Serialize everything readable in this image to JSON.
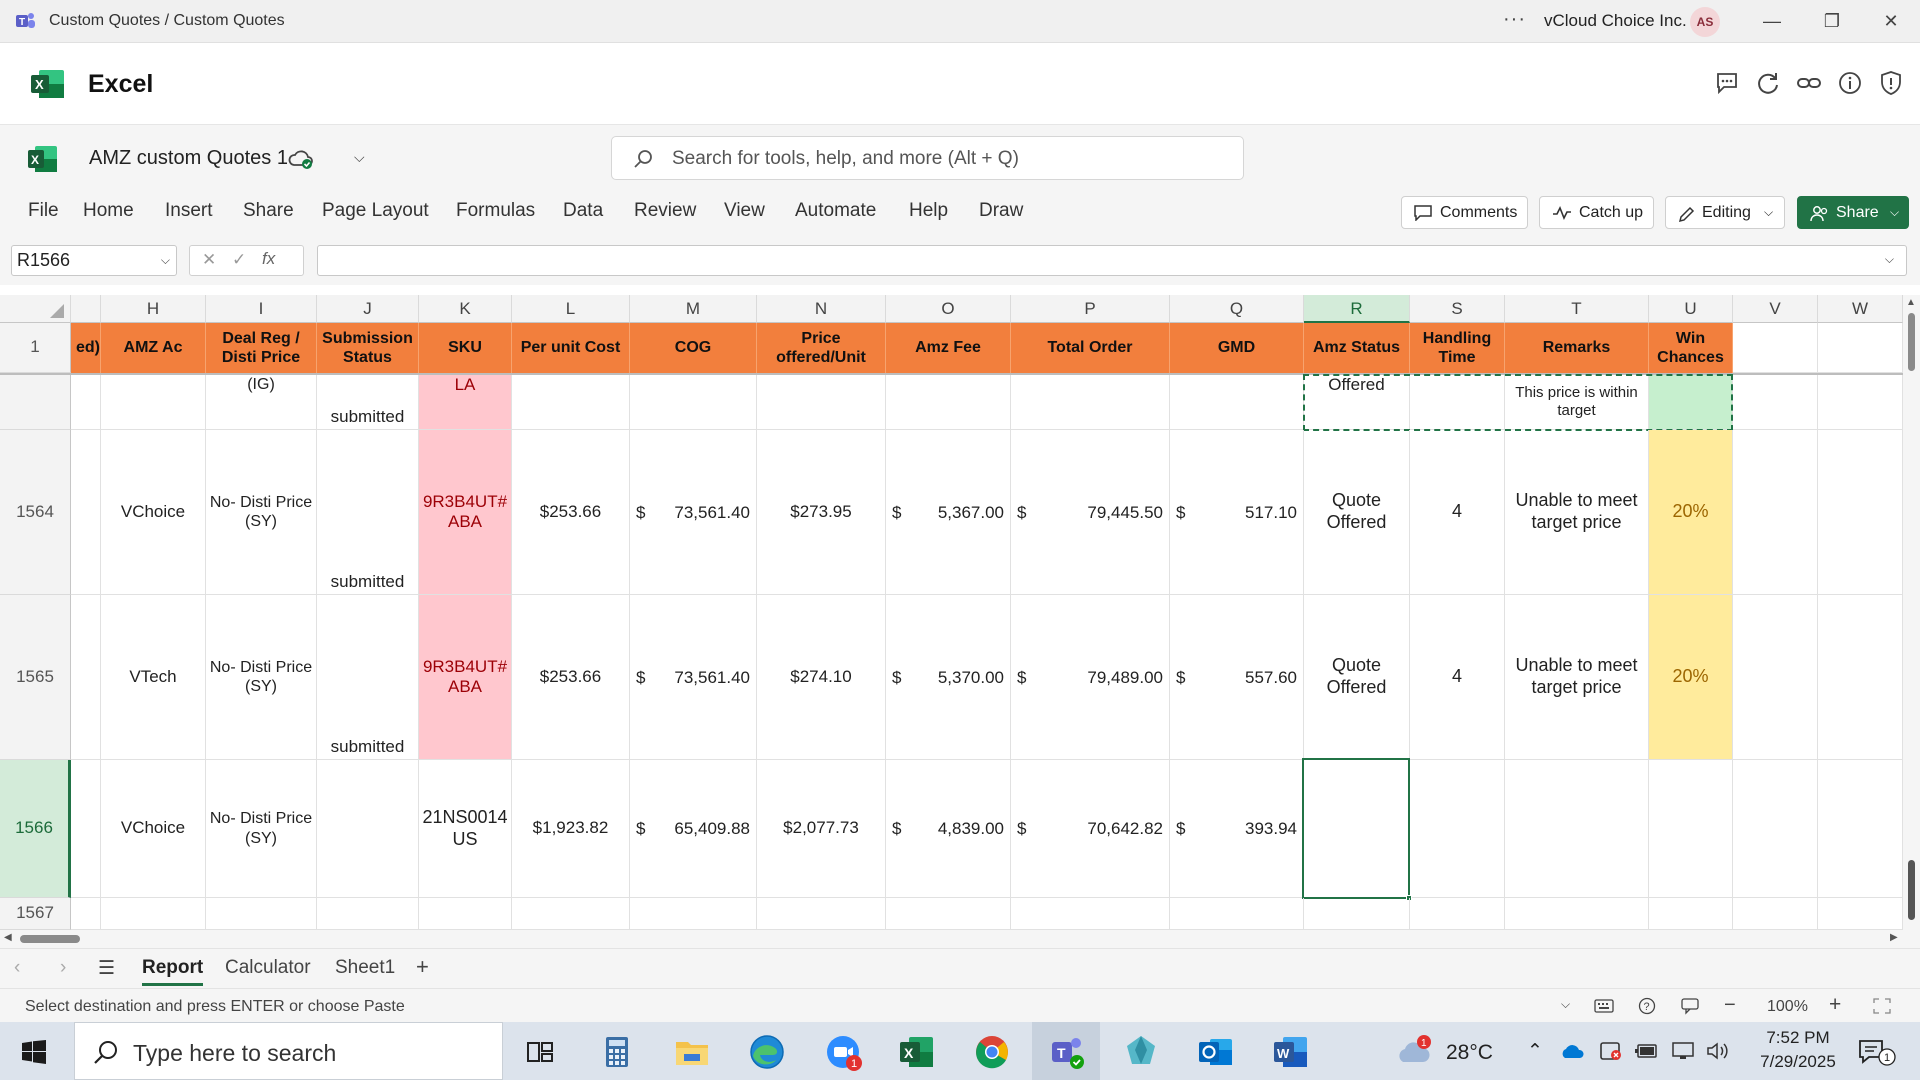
{
  "window": {
    "title": "Custom Quotes / Custom Quotes",
    "org": "vCloud Choice Inc.",
    "avatar": "AS",
    "dots": "···"
  },
  "app": {
    "name": "Excel"
  },
  "doc": {
    "name": "AMZ custom Quotes 1"
  },
  "search": {
    "placeholder": "Search for tools, help, and more (Alt + Q)"
  },
  "menu": {
    "items": [
      "File",
      "Home",
      "Insert",
      "Share",
      "Page Layout",
      "Formulas",
      "Data",
      "Review",
      "View",
      "Automate",
      "Help",
      "Draw"
    ],
    "comments": "Comments",
    "catchup": "Catch up",
    "editing": "Editing",
    "share": "Share"
  },
  "formula_bar": {
    "name_box": "R1566",
    "fx": "fx",
    "value": ""
  },
  "grid": {
    "column_letters": [
      "H",
      "I",
      "J",
      "K",
      "L",
      "M",
      "N",
      "O",
      "P",
      "Q",
      "R",
      "S",
      "T",
      "U",
      "V",
      "W"
    ],
    "header_row_number": "1",
    "partial_header": "ed)",
    "headers": {
      "H": "AMZ Ac",
      "I": "Deal Reg / Disti Price",
      "J": "Submission Status",
      "K": "SKU",
      "L": "Per unit Cost",
      "M": "COG",
      "N": "Price offered/Unit",
      "O": "Amz Fee",
      "P": "Total Order",
      "Q": "GMD",
      "R": "Amz Status",
      "S": "Handling Time",
      "T": "Remarks",
      "U": "Win Chances"
    },
    "partial_row": {
      "I": "(IG)",
      "J": "submitted",
      "K": "LA",
      "R": "Offered",
      "T": "This price is within target"
    },
    "rows": [
      {
        "num": "1564",
        "H": "VChoice",
        "I": "No- Disti Price (SY)",
        "J": "submitted",
        "K": "9R3B4UT# ABA",
        "L": "$253.66",
        "M_sym": "$",
        "M": "73,561.40",
        "N": "$273.95",
        "O_sym": "$",
        "O": "5,367.00",
        "P_sym": "$",
        "P": "79,445.50",
        "Q_sym": "$",
        "Q": "517.10",
        "R": "Quote Offered",
        "S": "4",
        "T": "Unable to meet target price",
        "U": "20%"
      },
      {
        "num": "1565",
        "H": "VTech",
        "I": "No- Disti Price (SY)",
        "J": "submitted",
        "K": "9R3B4UT# ABA",
        "L": "$253.66",
        "M_sym": "$",
        "M": "73,561.40",
        "N": "$274.10",
        "O_sym": "$",
        "O": "5,370.00",
        "P_sym": "$",
        "P": "79,489.00",
        "Q_sym": "$",
        "Q": "557.60",
        "R": "Quote Offered",
        "S": "4",
        "T": "Unable to meet target price",
        "U": "20%"
      },
      {
        "num": "1566",
        "H": "VChoice",
        "I": "No- Disti Price (SY)",
        "J": "",
        "K": "21NS0014 US",
        "L": "$1,923.82",
        "M_sym": "$",
        "M": "65,409.88",
        "N": "$2,077.73",
        "O_sym": "$",
        "O": "4,839.00",
        "P_sym": "$",
        "P": "70,642.82",
        "Q_sym": "$",
        "Q": "393.94",
        "R": "",
        "S": "",
        "T": "",
        "U": ""
      }
    ],
    "next_row_number": "1567"
  },
  "sheets": {
    "tabs": [
      "Report",
      "Calculator",
      "Sheet1"
    ],
    "active": "Report",
    "add": "+"
  },
  "status": {
    "message": "Select destination and press ENTER or choose Paste",
    "zoom": "100%"
  },
  "taskbar": {
    "search_placeholder": "Type here to search",
    "weather": "28°C",
    "time": "7:52 PM",
    "date": "7/29/2025",
    "weather_badge": "1",
    "zoom_badge": "1",
    "notification_count": "1"
  },
  "colors": {
    "header_orange": "#f27f3d",
    "excel_green": "#217346",
    "pink_fill": "#ffc7ce",
    "yellow_fill": "#ffeb9c",
    "green_fill": "#c6efce"
  }
}
